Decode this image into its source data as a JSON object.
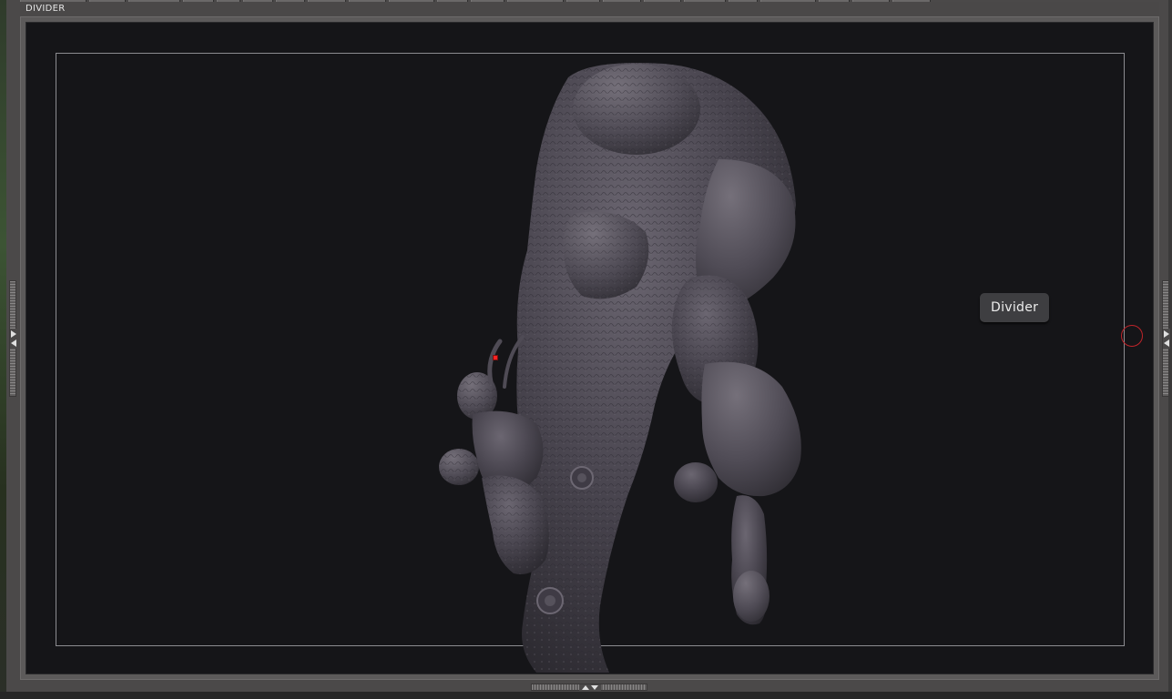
{
  "window": {
    "title": "DIVIDER"
  },
  "tooltip": {
    "text": "Divider"
  },
  "colors": {
    "canvas_background": "#151518",
    "panel": "#4b4949",
    "model_shade": "#4a4650",
    "cursor_ring": "#c0242a",
    "selection_dot": "#ff2222"
  },
  "icons": {
    "left_handle": [
      "arrow-right-icon",
      "arrow-left-icon"
    ],
    "right_handle": [
      "arrow-right-icon",
      "arrow-left-icon"
    ],
    "bottom_handle": [
      "arrow-up-icon",
      "arrow-down-icon"
    ]
  }
}
